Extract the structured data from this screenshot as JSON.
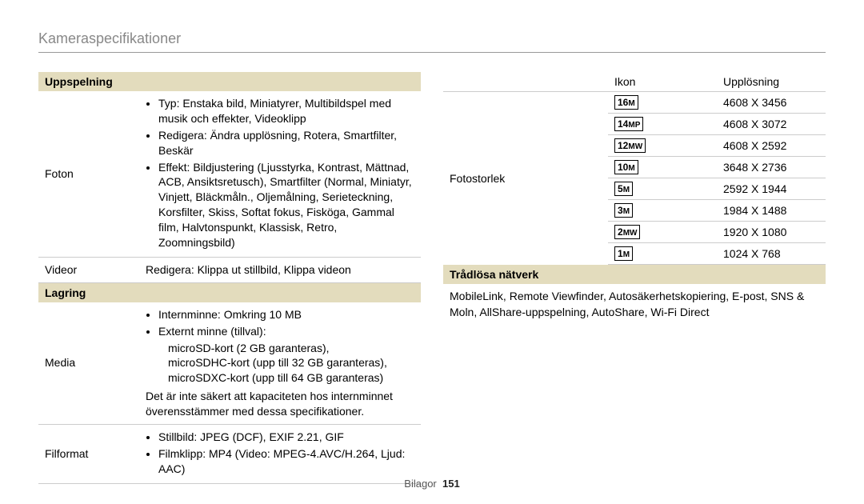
{
  "page_title": "Kameraspecifikationer",
  "footer_label": "Bilagor",
  "footer_page": "151",
  "left": {
    "sections": {
      "playback_header": "Uppspelning",
      "storage_header": "Lagring"
    },
    "rows": {
      "foton_label": "Foton",
      "foton_b1": "Typ: Enstaka bild, Miniatyrer, Multibildspel med musik och effekter, Videoklipp",
      "foton_b2": "Redigera: Ändra upplösning, Rotera, Smartfilter, Beskär",
      "foton_b3": "Effekt: Bildjustering (Ljusstyrka, Kontrast, Mättnad, ACB, Ansiktsretusch), Smartfilter (Normal, Miniatyr, Vinjett, Bläckmåln., Oljemålning, Serieteckning, Korsfilter, Skiss, Softat fokus, Fisköga, Gammal film, Halvtonspunkt, Klassisk, Retro, Zoomningsbild)",
      "videor_label": "Videor",
      "videor_val": "Redigera: Klippa ut stillbild, Klippa videon",
      "media_label": "Media",
      "media_b1": "Internminne: Omkring 10 MB",
      "media_b2": "Externt minne (tillval):",
      "media_sub1": "microSD-kort (2 GB garanteras),",
      "media_sub2": "microSDHC-kort (upp till 32 GB garanteras),",
      "media_sub3": "microSDXC-kort (upp till 64 GB garanteras)",
      "media_note": "Det är inte säkert att kapaciteten hos internminnet överensstämmer med dessa specifikationer.",
      "filformat_label": "Filformat",
      "filformat_b1": "Stillbild: JPEG (DCF), EXIF 2.21, GIF",
      "filformat_b2": "Filmklipp: MP4 (Video: MPEG-4.AVC/H.264, Ljud: AAC)"
    }
  },
  "right": {
    "hdr_icon": "Ikon",
    "hdr_res": "Upplösning",
    "fotostorlek_label": "Fotostorlek",
    "sizes": [
      {
        "num": "16",
        "suf": "M",
        "res": "4608 X 3456"
      },
      {
        "num": "14",
        "suf": "MP",
        "res": "4608 X 3072"
      },
      {
        "num": "12",
        "suf": "MW",
        "res": "4608 X 2592"
      },
      {
        "num": "10",
        "suf": "M",
        "res": "3648 X 2736"
      },
      {
        "num": "5",
        "suf": "M",
        "res": "2592 X 1944"
      },
      {
        "num": "3",
        "suf": "M",
        "res": "1984 X 1488"
      },
      {
        "num": "2",
        "suf": "MW",
        "res": "1920 X 1080"
      },
      {
        "num": "1",
        "suf": "M",
        "res": "1024 X 768"
      }
    ],
    "wireless_header": "Trådlösa nätverk",
    "wireless_body": "MobileLink, Remote Viewfinder, Autosäkerhetskopiering, E-post, SNS & Moln, AllShare-uppspelning, AutoShare, Wi-Fi Direct"
  }
}
